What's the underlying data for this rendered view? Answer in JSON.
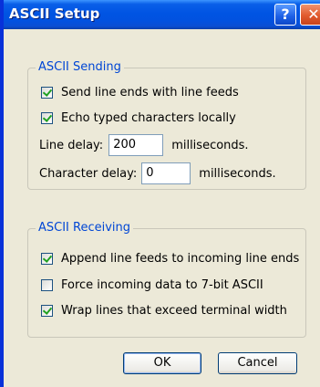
{
  "window": {
    "title": "ASCII Setup",
    "help_glyph": "?",
    "close_glyph": "✕"
  },
  "sending": {
    "title": "ASCII Sending",
    "send_line_ends": {
      "label": "Send line ends with line feeds",
      "checked": true
    },
    "echo_typed": {
      "label": "Echo typed characters locally",
      "checked": true
    },
    "line_delay": {
      "label": "Line delay:",
      "value": "200",
      "unit": "milliseconds."
    },
    "char_delay": {
      "label": "Character delay:",
      "value": "0",
      "unit": "milliseconds."
    }
  },
  "receiving": {
    "title": "ASCII Receiving",
    "append_line_feeds": {
      "label": "Append line feeds to incoming line ends",
      "checked": true
    },
    "force_7bit": {
      "label": "Force incoming data to 7-bit ASCII",
      "checked": false
    },
    "wrap_lines": {
      "label": "Wrap lines that exceed terminal width",
      "checked": true
    }
  },
  "buttons": {
    "ok": "OK",
    "cancel": "Cancel"
  }
}
